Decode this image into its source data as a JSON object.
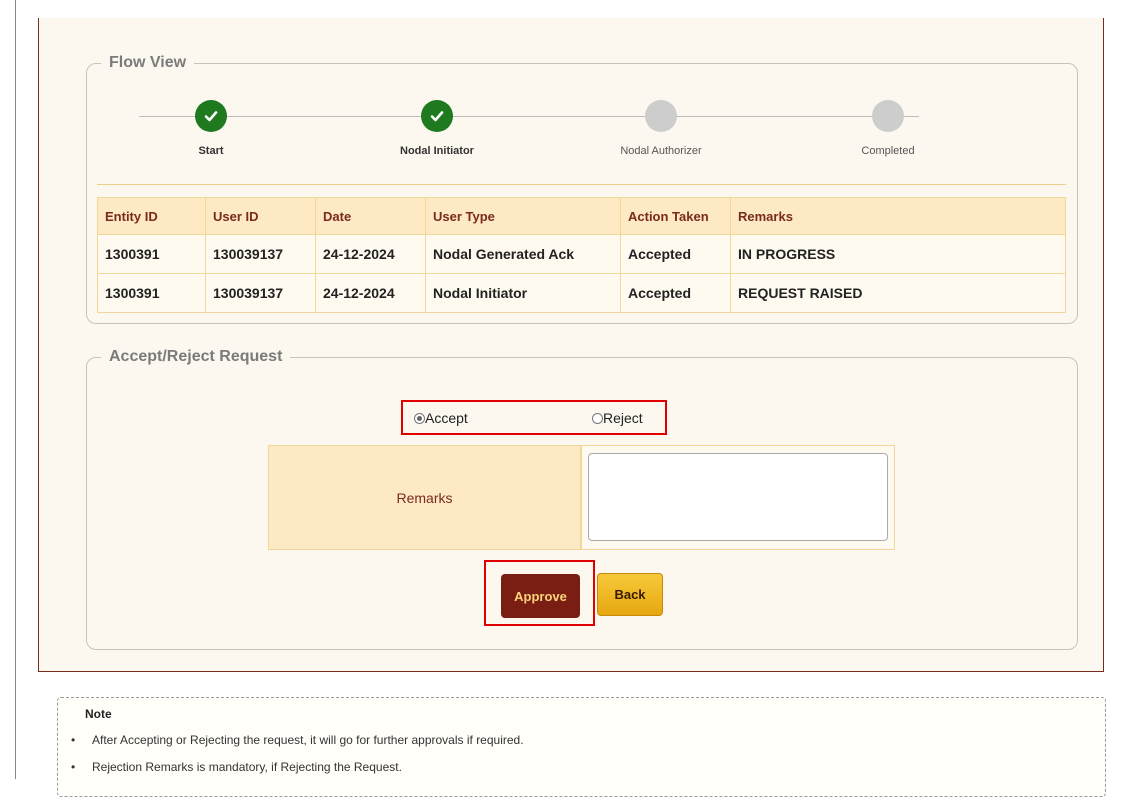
{
  "flow_view": {
    "legend": "Flow View",
    "steps": [
      {
        "label": "Start",
        "status": "done"
      },
      {
        "label": "Nodal Initiator",
        "status": "done"
      },
      {
        "label": "Nodal Authorizer",
        "status": "pending"
      },
      {
        "label": "Completed",
        "status": "pending"
      }
    ],
    "table": {
      "headers": [
        "Entity ID",
        "User ID",
        "Date",
        "User Type",
        "Action Taken",
        "Remarks"
      ],
      "rows": [
        [
          "1300391",
          "130039137",
          "24-12-2024",
          "Nodal Generated Ack",
          "Accepted",
          "IN PROGRESS"
        ],
        [
          "1300391",
          "130039137",
          "24-12-2024",
          "Nodal Initiator",
          "Accepted",
          "REQUEST RAISED"
        ]
      ]
    }
  },
  "accept_reject": {
    "legend": "Accept/Reject Request",
    "accept_label": "Accept",
    "reject_label": "Reject",
    "selected": "Accept",
    "remarks_label": "Remarks",
    "remarks_value": "",
    "approve_label": "Approve",
    "back_label": "Back"
  },
  "note": {
    "title": "Note",
    "items": [
      "After Accepting or Rejecting the request, it will go for further approvals if required.",
      "Rejection Remarks is mandatory, if Rejecting the Request."
    ]
  },
  "colors": {
    "accent": "#7a2a1e",
    "done_step": "#1f7a1f",
    "pending_step": "#cdcdcd",
    "highlight_box": "#e00000",
    "table_header_bg": "#fde9c4"
  }
}
